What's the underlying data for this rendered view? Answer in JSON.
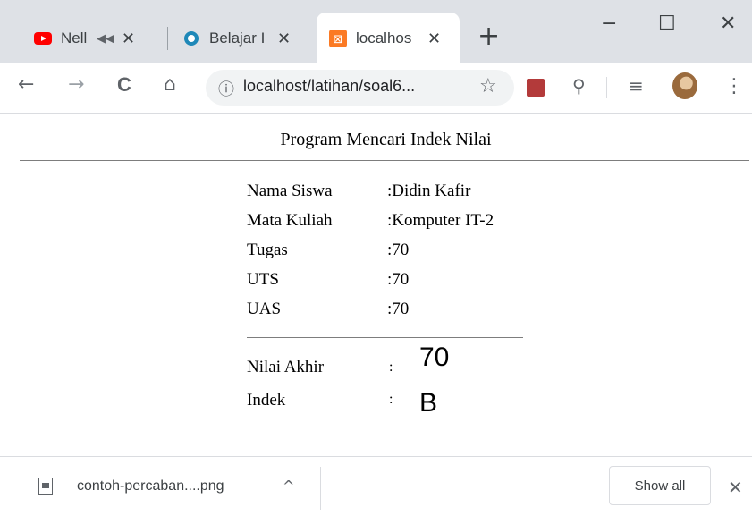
{
  "browser": {
    "tabs": [
      {
        "title": "Nell",
        "audio_icon": "speaker-mute-icon",
        "favicon": "youtube-icon"
      },
      {
        "title": "Belajar I",
        "favicon": "circle-logo-icon"
      },
      {
        "title": "localhos",
        "favicon": "xampp-icon",
        "active": true
      }
    ],
    "new_tab": "+",
    "window": {
      "minimize": "−",
      "maximize": "☐",
      "close": "✕"
    },
    "toolbar": {
      "back": "←",
      "forward": "→",
      "reload": "C",
      "home": "⌂",
      "info": "ⓘ",
      "url": "localhost/latihan/soal6...",
      "star": "☆",
      "search": "⚲",
      "list": "≡",
      "menu": "⋮"
    }
  },
  "page": {
    "title": "Program Mencari Indek Nilai",
    "rows": [
      {
        "label": "Nama Siswa",
        "value": ":Didin Kafir"
      },
      {
        "label": "Mata Kuliah",
        "value": ":Komputer IT-2"
      },
      {
        "label": "Tugas",
        "value": ":70"
      },
      {
        "label": "UTS",
        "value": ":70"
      },
      {
        "label": "UAS",
        "value": ":70"
      }
    ],
    "result": {
      "label_akhir": "Nilai Akhir",
      "label_indek": "Indek",
      "colon": ":",
      "nilai_akhir": "70",
      "indek": "B"
    }
  },
  "downloads": {
    "file": "contoh-percaban....png",
    "caret": "^",
    "show_all": "Show all",
    "close": "✕"
  },
  "colors": {
    "tabbar": "#dee1e6",
    "omnibox": "#f1f3f4",
    "youtube": "#ff0000",
    "belajar": "#1e88b8",
    "xampp": "#fb7a24"
  }
}
